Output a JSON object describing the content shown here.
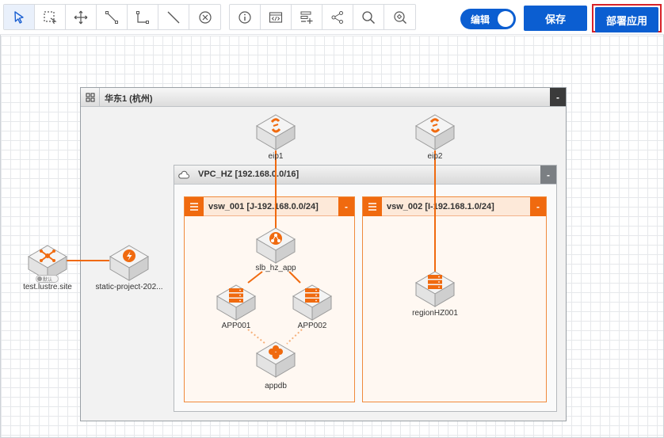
{
  "toolbar": {
    "tools": [
      {
        "id": "select",
        "icon": "pointer-arrow-icon"
      },
      {
        "id": "marquee",
        "icon": "marquee-select-icon"
      },
      {
        "id": "pan",
        "icon": "move-arrows-icon"
      },
      {
        "id": "connector-elbow",
        "icon": "elbow-connector-icon"
      },
      {
        "id": "connector-right",
        "icon": "right-angle-connector-icon"
      },
      {
        "id": "line",
        "icon": "straight-line-icon"
      },
      {
        "id": "delete",
        "icon": "circle-x-icon"
      }
    ],
    "tools2": [
      {
        "id": "info",
        "icon": "info-icon"
      },
      {
        "id": "code",
        "icon": "code-view-icon"
      },
      {
        "id": "add-panel",
        "icon": "add-list-icon"
      },
      {
        "id": "share",
        "icon": "share-icon"
      },
      {
        "id": "search",
        "icon": "search-icon"
      },
      {
        "id": "locate",
        "icon": "locate-tag-icon"
      }
    ],
    "edit_label": "编辑",
    "save_label": "保存",
    "deploy_label": "部署应用"
  },
  "diagram": {
    "region": {
      "title": "华东1 (杭州)",
      "collapse": "-"
    },
    "vpc": {
      "title": "VPC_HZ [192.168.0.0/16]",
      "collapse": "-"
    },
    "vsw1": {
      "title": "vsw_001 [J-192.168.0.0/24]",
      "collapse": "-"
    },
    "vsw2": {
      "title": "vsw_002 [I-192.168.1.0/24]",
      "collapse": "-"
    },
    "nodes": {
      "eip1": "eip1",
      "eip2": "eip2",
      "slb": "slb_hz_app",
      "app1": "APP001",
      "app2": "APP002",
      "appdb": "appdb",
      "region_hz": "regionHZ001",
      "site": "test.lustre.site",
      "static": "static-project-202...",
      "site_badge": "默认"
    }
  },
  "colors": {
    "primary": "#0b5ed1",
    "orange": "#f06a0f",
    "deploy_highlight": "#d8232a"
  }
}
